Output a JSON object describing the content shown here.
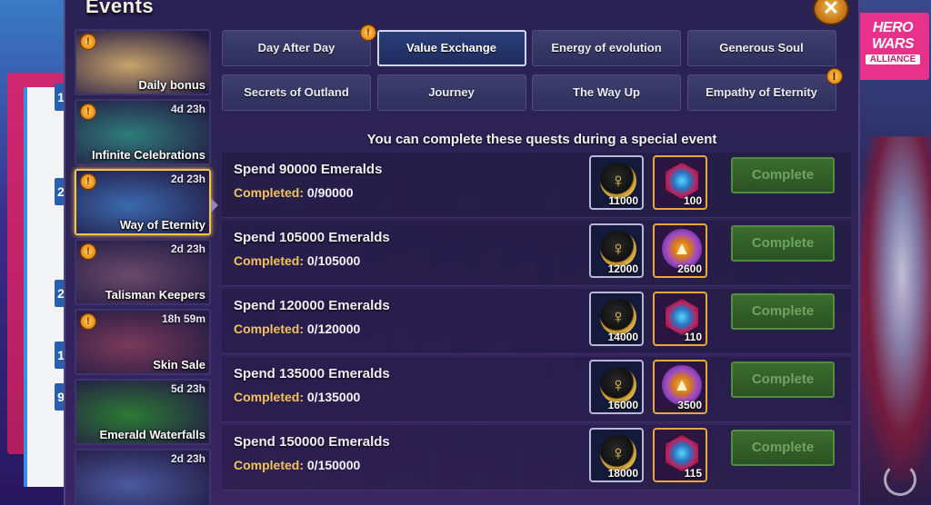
{
  "window": {
    "title": "Events"
  },
  "branding": {
    "line1": "HERO WARS",
    "line2": "ALLIANCE"
  },
  "sidebar": {
    "items": [
      {
        "label": "Daily bonus",
        "timer": "",
        "gift": true,
        "selected": false,
        "art_color": "#c7a36a"
      },
      {
        "label": "Infinite Celebrations",
        "timer": "4d 23h",
        "gift": true,
        "selected": false,
        "art_color": "#2e7d7a"
      },
      {
        "label": "Way of Eternity",
        "timer": "2d 23h",
        "gift": true,
        "selected": true,
        "art_color": "#3a6ab0"
      },
      {
        "label": "Talisman Keepers",
        "timer": "2d 23h",
        "gift": true,
        "selected": false,
        "art_color": "#6a4a6a"
      },
      {
        "label": "Skin Sale",
        "timer": "18h 59m",
        "gift": true,
        "selected": false,
        "art_color": "#7a3a5a"
      },
      {
        "label": "Emerald Waterfalls",
        "timer": "5d 23h",
        "gift": false,
        "selected": false,
        "art_color": "#2c7a34"
      },
      {
        "label": "",
        "timer": "2d 23h",
        "gift": false,
        "selected": false,
        "art_color": "#4a5aa0"
      }
    ]
  },
  "tabs": [
    {
      "label": "Day After Day",
      "active": false,
      "gift": false
    },
    {
      "label": "Value Exchange",
      "active": true,
      "gift": false
    },
    {
      "label": "Energy of evolution",
      "active": false,
      "gift": false
    },
    {
      "label": "Generous Soul",
      "active": false,
      "gift": false
    },
    {
      "label": "Secrets of Outland",
      "active": false,
      "gift": false
    },
    {
      "label": "Journey",
      "active": false,
      "gift": false
    },
    {
      "label": "The Way Up",
      "active": false,
      "gift": false
    },
    {
      "label": "Empathy of Eternity",
      "active": false,
      "gift": true
    }
  ],
  "quests": {
    "header": "You can complete these quests during a special event",
    "progress_label": "Completed:",
    "button_label": "Complete",
    "items": [
      {
        "title": "Spend 90000 Emeralds",
        "progress": "0/90000",
        "reward1": {
          "icon": "ankh-coin-icon",
          "count": "11000"
        },
        "reward2": {
          "icon": "soul-gem-icon",
          "count": "100"
        }
      },
      {
        "title": "Spend 105000 Emeralds",
        "progress": "0/105000",
        "reward1": {
          "icon": "ankh-coin-icon",
          "count": "12000"
        },
        "reward2": {
          "icon": "rune-orb-icon",
          "count": "2600"
        }
      },
      {
        "title": "Spend 120000 Emeralds",
        "progress": "0/120000",
        "reward1": {
          "icon": "ankh-coin-icon",
          "count": "14000"
        },
        "reward2": {
          "icon": "soul-gem-icon",
          "count": "110"
        }
      },
      {
        "title": "Spend 135000 Emeralds",
        "progress": "0/135000",
        "reward1": {
          "icon": "ankh-coin-icon",
          "count": "16000"
        },
        "reward2": {
          "icon": "rune-orb-icon",
          "count": "3500"
        }
      },
      {
        "title": "Spend 150000 Emeralds",
        "progress": "0/150000",
        "reward1": {
          "icon": "ankh-coin-icon",
          "count": "18000"
        },
        "reward2": {
          "icon": "soul-gem-icon",
          "count": "115"
        }
      }
    ]
  },
  "background_left_numbers": [
    "1",
    "2",
    "2",
    "1",
    "9"
  ]
}
